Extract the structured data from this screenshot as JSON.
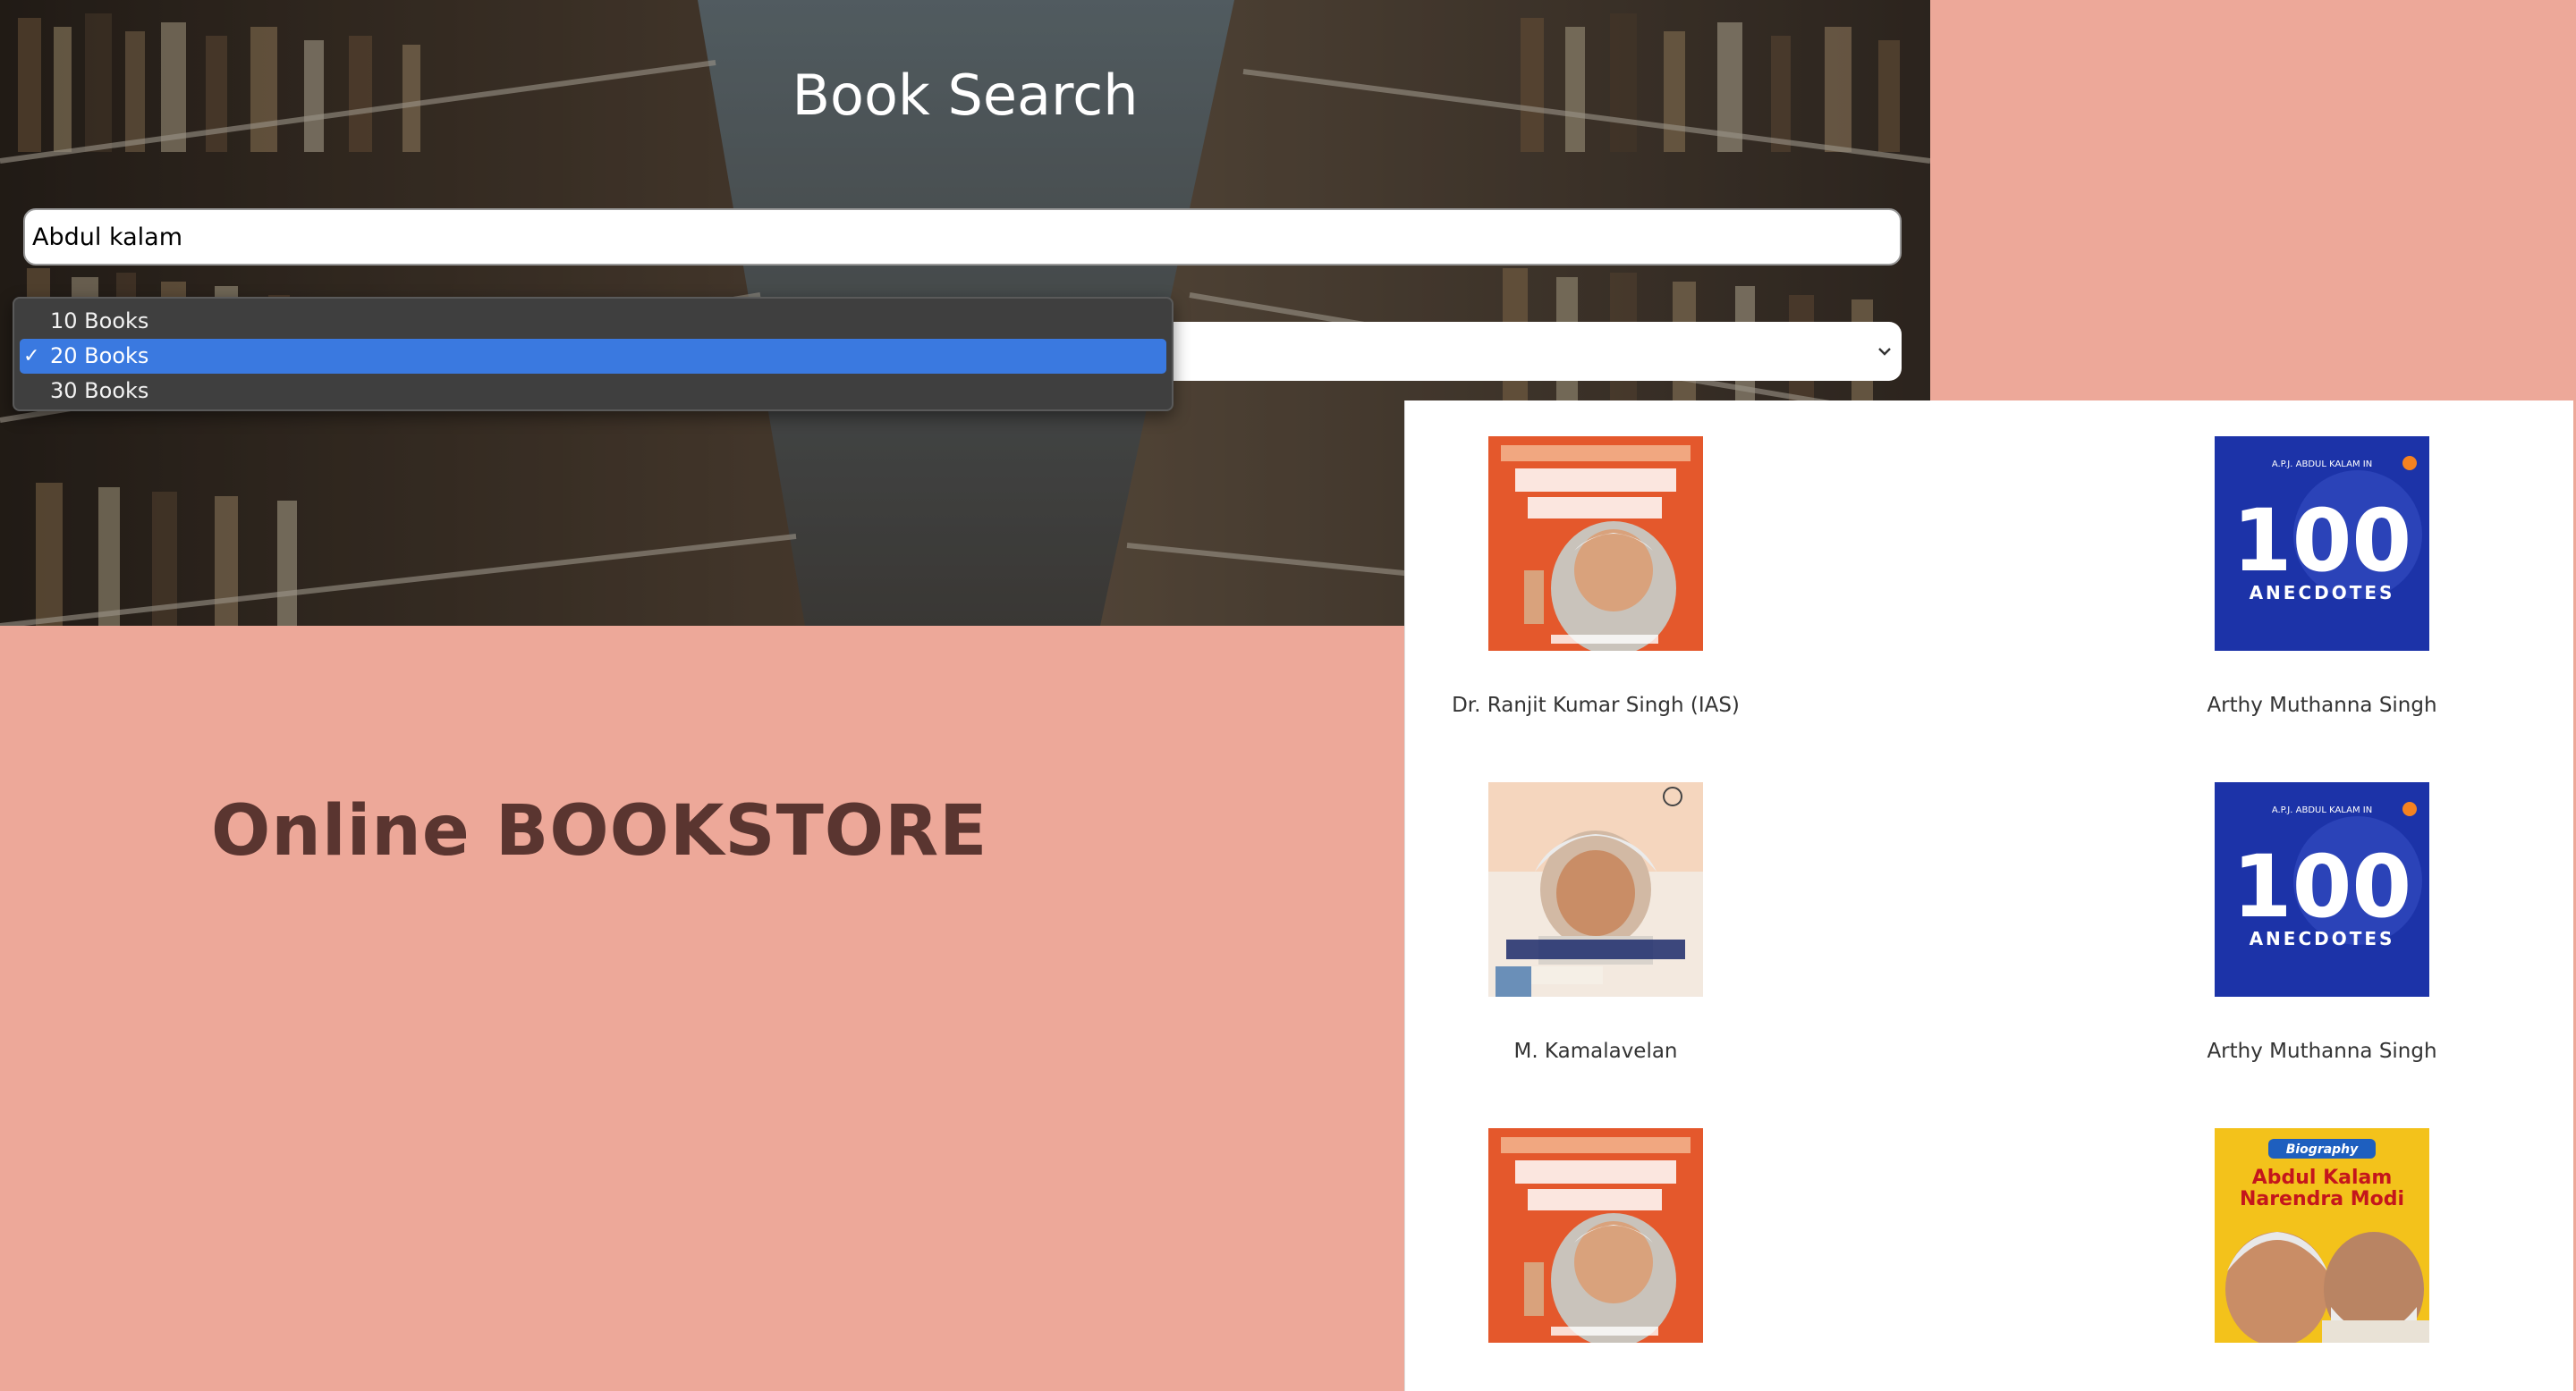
{
  "hero": {
    "title": "Book Search"
  },
  "search": {
    "value": "Abdul kalam"
  },
  "count_select": {
    "options": [
      "10 Books",
      "20 Books",
      "30 Books"
    ],
    "selected": "20 Books",
    "checkmark": "✓"
  },
  "brand": {
    "name": "Online BOOKSTORE"
  },
  "results": [
    {
      "author": "Dr. Ranjit Kumar Singh (IAS)",
      "cover": "orange-hindi-cover"
    },
    {
      "author": "Arthy Muthanna Singh",
      "cover": "blue-100-anecdotes-cover"
    },
    {
      "author": "M. Kamalavelan",
      "cover": "tamil-portrait-cover"
    },
    {
      "author": "Arthy Muthanna Singh",
      "cover": "blue-100-anecdotes-cover"
    },
    {
      "author": "",
      "cover": "orange-hindi-cover"
    },
    {
      "author": "",
      "cover": "yellow-biography-cover"
    }
  ],
  "cover_text": {
    "anecdotes_top": "A.P.J. ABDUL KALAM IN",
    "anecdotes_number": "100",
    "anecdotes_word": "ANECDOTES",
    "biography_tag": "Biography",
    "biography_line1": "Abdul Kalam",
    "biography_line2": "Narendra Modi"
  },
  "colors": {
    "page_bg": "#eda899",
    "brand_text": "#5a3530",
    "selected_option": "#3a79e0",
    "cover_orange": "#e4582c",
    "cover_blue": "#1c33a8",
    "cover_yellow": "#f3c21b"
  }
}
